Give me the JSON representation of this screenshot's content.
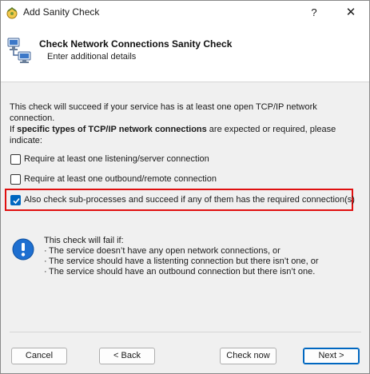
{
  "window": {
    "title": "Add Sanity Check",
    "help_label": "?",
    "close_label": "✕"
  },
  "header": {
    "title": "Check Network Connections Sanity Check",
    "subtitle": "Enter additional details"
  },
  "description": {
    "line1": "This check will succeed if your service has is at least one open TCP/IP network connection.",
    "line2_prefix": "If ",
    "line2_bold": "specific types of TCP/IP network connections",
    "line2_suffix": " are expected or required, please indicate:"
  },
  "options": [
    {
      "label": "Require at least one listening/server connection",
      "checked": false
    },
    {
      "label": "Require at least one outbound/remote connection",
      "checked": false
    },
    {
      "label": "Also check sub-processes and succeed if any of them has the required connection(s)",
      "checked": true
    }
  ],
  "info": {
    "heading": "This check will fail if:",
    "items": [
      "The service doesn’t have any open network connections, or",
      "The service should have a listenting connection but there isn’t one, or",
      "The service should have an outbound connection but there isn’t one."
    ],
    "bullet": "·"
  },
  "buttons": {
    "cancel": "Cancel",
    "back": "< Back",
    "check_now": "Check now",
    "next": "Next >"
  },
  "colors": {
    "accent": "#0067c0",
    "highlight": "#e01010"
  }
}
